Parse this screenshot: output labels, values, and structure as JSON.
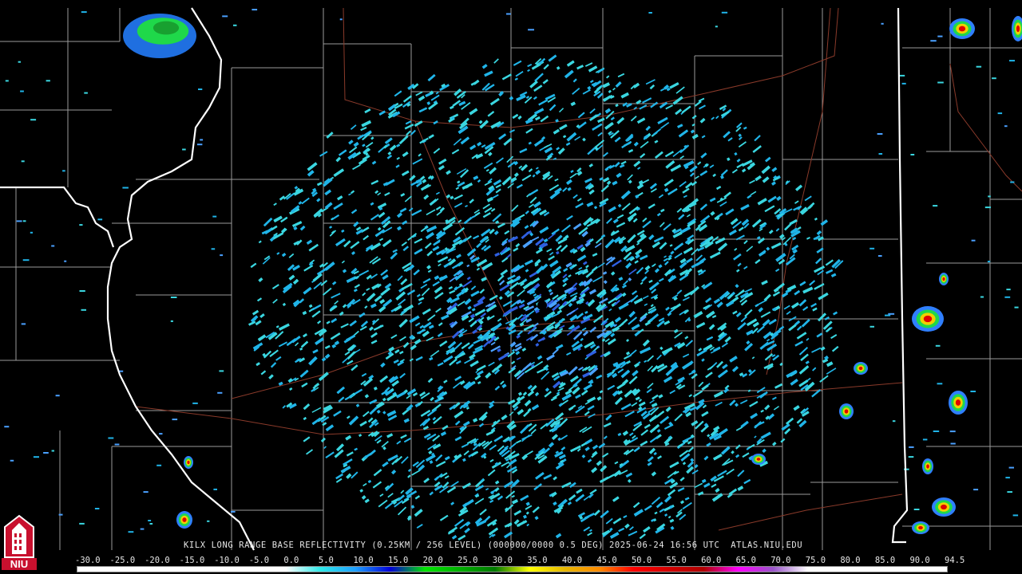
{
  "caption": "KILX LONG RANGE BASE REFLECTIVITY (0.25KM / 256 LEVEL) (000000/0000 0.5 DEG) 2025-06-24 16:56 UTC  ATLAS.NIU.EDU",
  "scale": {
    "labels": [
      "-30.0",
      "-25.0",
      "-20.0",
      "-15.0",
      "-10.0",
      "-5.0",
      "0.0",
      "5.0",
      "10.0",
      "15.0",
      "20.0",
      "25.0",
      "30.0",
      "35.0",
      "40.0",
      "45.0",
      "50.0",
      "55.0",
      "60.0",
      "65.0",
      "70.0",
      "75.0",
      "80.0",
      "85.0",
      "90.0",
      "94.5"
    ],
    "colors": [
      "#ffffff",
      "#ffffff",
      "#ffffff",
      "#ffffff",
      "#ffffff",
      "#ffffff",
      "#ffffff",
      "#2ee8e8",
      "#1f9fff",
      "#0000d8",
      "#00e600",
      "#00b000",
      "#007a00",
      "#ffff00",
      "#e6b800",
      "#ff8c00",
      "#ff0000",
      "#d40000",
      "#b00000",
      "#ff00ff",
      "#9955c9",
      "#ffffff",
      "#ffffff",
      "#ffffff",
      "#ffffff",
      "#ffffff"
    ]
  },
  "logo": {
    "text": "NIU",
    "color": "#c8102e"
  },
  "map": {
    "station": "KILX",
    "background": "#000000",
    "county_line_color": "#9a9a9a",
    "state_line_color": "#ffffff",
    "highway_color": "#8a3a2a",
    "echo_colors": [
      "#3ad6e0",
      "#20b4e8",
      "#4aa0ff",
      "#2f5fe0"
    ]
  }
}
